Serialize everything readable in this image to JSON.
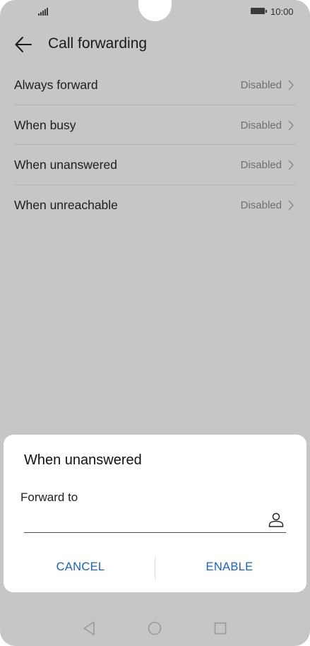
{
  "status_bar": {
    "time": "10:00"
  },
  "app_bar": {
    "title": "Call forwarding"
  },
  "list": [
    {
      "label": "Always forward",
      "value": "Disabled"
    },
    {
      "label": "When busy",
      "value": "Disabled"
    },
    {
      "label": "When unanswered",
      "value": "Disabled"
    },
    {
      "label": "When unreachable",
      "value": "Disabled"
    }
  ],
  "dialog": {
    "title": "When unanswered",
    "field_label": "Forward to",
    "field_value": "",
    "cancel_label": "CANCEL",
    "enable_label": "ENABLE"
  },
  "colors": {
    "background_dim": "#c6c6c6",
    "accent": "#1b62b8",
    "dialog_bg": "#ffffff"
  },
  "icons": [
    "back-arrow-icon",
    "chevron-right-icon",
    "contact-icon",
    "signal-icon",
    "battery-icon",
    "nav-back-icon",
    "nav-home-icon",
    "nav-recent-icon"
  ]
}
